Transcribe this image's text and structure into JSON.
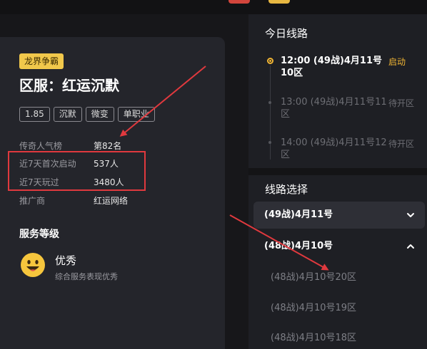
{
  "server": {
    "tag": "龙界争霸",
    "title": "区服：红运沉默",
    "chips": [
      "1.85",
      "沉默",
      "微变",
      "单职业"
    ]
  },
  "stats": [
    {
      "label": "传奇人气榜",
      "value": "第82名"
    },
    {
      "label": "近7天首次启动",
      "value": "537人"
    },
    {
      "label": "近7天玩过",
      "value": "3480人"
    },
    {
      "label": "推广商",
      "value": "红运网络"
    }
  ],
  "service": {
    "section_title": "服务等级",
    "level": "优秀",
    "description": "综合服务表现优秀"
  },
  "today_routes": {
    "title": "今日线路",
    "items": [
      {
        "text": "12:00 (49战)4月11号10区",
        "status": "启动",
        "active": true
      },
      {
        "text": "13:00 (49战)4月11号11区",
        "status": "待开区",
        "active": false
      },
      {
        "text": "14:00 (49战)4月11号12区",
        "status": "待开区",
        "active": false
      }
    ]
  },
  "line_select": {
    "title": "线路选择",
    "groups": [
      {
        "label": "(49战)4月11号",
        "expanded": false
      },
      {
        "label": "(48战)4月10号",
        "expanded": true
      }
    ],
    "sub_routes": [
      "(48战)4月10号20区",
      "(48战)4月10号19区",
      "(48战)4月10号18区"
    ]
  },
  "colors": {
    "accent_yellow": "#f0b433",
    "annotation_red": "#e0393e",
    "card_bg": "#24252b"
  }
}
